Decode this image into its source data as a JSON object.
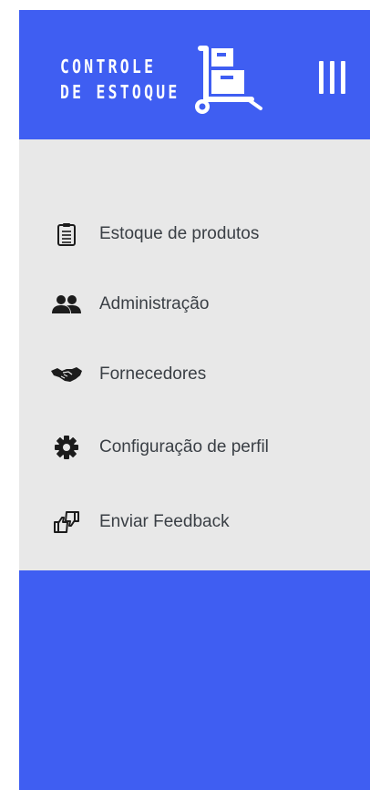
{
  "header": {
    "logo": {
      "line1": "CONTROLE",
      "line2": "DE ESTOQUE"
    },
    "menu_icon": "hamburger-vertical-icon"
  },
  "nav": {
    "items": [
      {
        "label": "Estoque de produtos",
        "icon": "clipboard-list-icon"
      },
      {
        "label": "Administração",
        "icon": "users-icon"
      },
      {
        "label": "Fornecedores",
        "icon": "handshake-icon"
      },
      {
        "label": "Configuração de perfil",
        "icon": "gear-icon"
      },
      {
        "label": "Enviar Feedback",
        "icon": "thumbs-feedback-icon"
      }
    ]
  },
  "colors": {
    "brand_blue": "#3f5ef2",
    "panel_gray": "#e8e8e8",
    "text": "#3a3f45",
    "icon": "#1c1c1c"
  }
}
